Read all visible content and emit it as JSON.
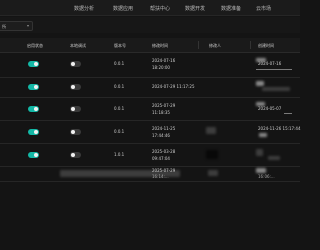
{
  "nav": {
    "items": [
      {
        "label": "数据分析"
      },
      {
        "label": "数据应用"
      },
      {
        "label": "帮扶中心"
      },
      {
        "label": "数据开发"
      },
      {
        "label": "数据准备"
      },
      {
        "label": "云市场"
      }
    ]
  },
  "toolbar": {
    "env_label": "所"
  },
  "table": {
    "columns": [
      "启用状态",
      "本地调试",
      "版本号",
      "修改时间",
      "修改人",
      "创建时间"
    ],
    "rows": [
      {
        "enabled": true,
        "debug": false,
        "version": "0.0.1",
        "modified": [
          "2024-07-16",
          "18:20:00"
        ],
        "created": [
          "2024-07-16"
        ]
      },
      {
        "enabled": true,
        "debug": false,
        "version": "0.0.1",
        "modified": [
          "2024-07-29 11:17:25"
        ],
        "created": []
      },
      {
        "enabled": true,
        "debug": false,
        "version": "0.0.1",
        "modified": [
          "2025-07-29",
          "11:18:35"
        ],
        "created": [
          "2024-05-07"
        ]
      },
      {
        "enabled": true,
        "debug": false,
        "version": "0.0.1",
        "modified": [
          "2024-11-25",
          "17:44:46"
        ],
        "created": [
          "2024-11-26 15:17:44"
        ]
      },
      {
        "enabled": true,
        "debug": false,
        "version": "1.0.1",
        "modified": [
          "2025-03-28",
          "09:47:04"
        ],
        "created": []
      },
      {
        "enabled": null,
        "debug": null,
        "version": "",
        "modified": [
          "2025-07-29",
          "16:14:..."
        ],
        "created": [
          "16:06:..."
        ]
      }
    ]
  },
  "colors": {
    "toggle_on": "#13b8a6",
    "toggle_off": "#3a3a3a",
    "background": "#141414"
  }
}
